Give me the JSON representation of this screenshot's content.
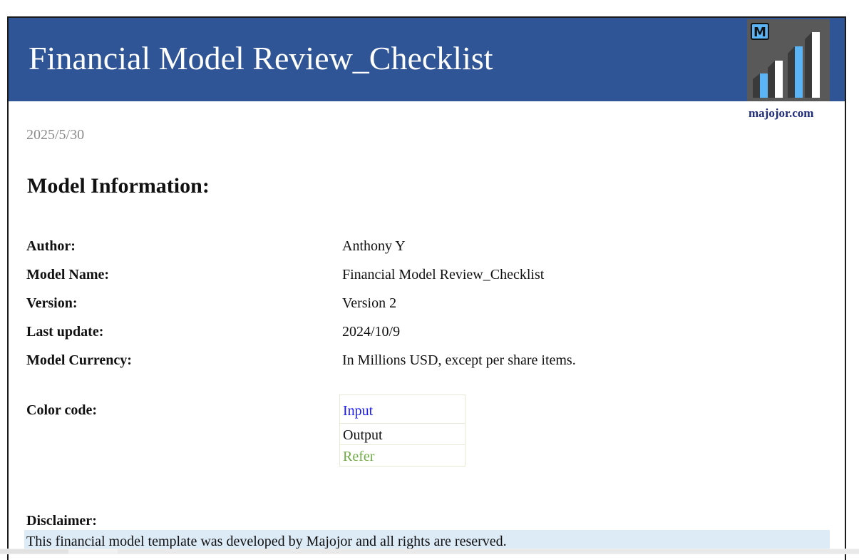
{
  "header": {
    "title": "Financial Model Review_Checklist",
    "background_color": "#2f5597",
    "logo": {
      "letter": "M",
      "icon": "bar-chart-logo-icon"
    }
  },
  "site_link": "majojor.com",
  "date": "2025/5/30",
  "section": {
    "title": "Model Information:"
  },
  "info": {
    "author_label": "Author:",
    "author_value": "Anthony Y",
    "model_name_label": "Model Name:",
    "model_name_value": "Financial Model Review_Checklist",
    "version_label": "Version:",
    "version_value": "Version 2",
    "last_update_label": "Last update:",
    "last_update_value": "2024/10/9",
    "currency_label": "Model Currency:",
    "currency_value": "In Millions USD, except per share items."
  },
  "color_code": {
    "label": "Color code:",
    "input_label": "Input",
    "input_color": "#1a1aff",
    "output_label": "Output",
    "output_color": "#111111",
    "refer_label": "Refer",
    "refer_color": "#70ad47"
  },
  "disclaimer": {
    "label": "Disclaimer:",
    "text": "This financial model template was developed by Majojor and all rights are reserved.",
    "band_color": "#ddebf7"
  }
}
